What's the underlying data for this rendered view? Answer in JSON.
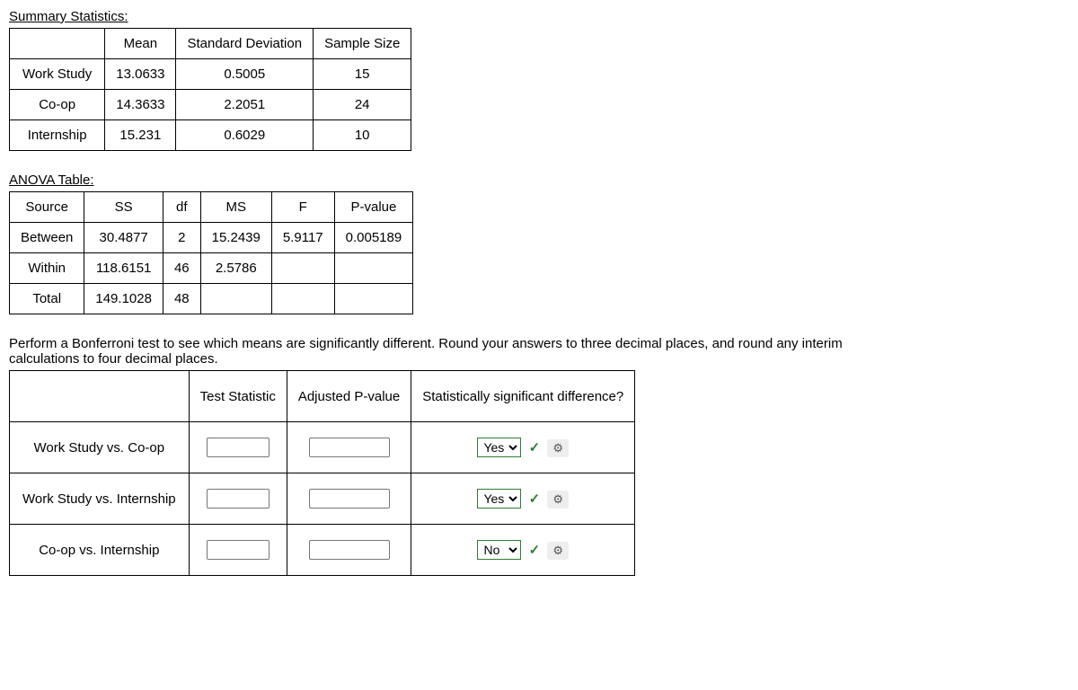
{
  "summary": {
    "title": "Summary Statistics:",
    "headers": {
      "mean": "Mean",
      "sd": "Standard Deviation",
      "n": "Sample Size"
    },
    "rows": [
      {
        "label": "Work Study",
        "mean": "13.0633",
        "sd": "0.5005",
        "n": "15"
      },
      {
        "label": "Co-op",
        "mean": "14.3633",
        "sd": "2.2051",
        "n": "24"
      },
      {
        "label": "Internship",
        "mean": "15.231",
        "sd": "0.6029",
        "n": "10"
      }
    ]
  },
  "anova": {
    "title": "ANOVA Table:",
    "headers": {
      "source": "Source",
      "ss": "SS",
      "df": "df",
      "ms": "MS",
      "f": "F",
      "p": "P-value"
    },
    "rows": [
      {
        "source": "Between",
        "ss": "30.4877",
        "df": "2",
        "ms": "15.2439",
        "f": "5.9117",
        "p": "0.005189"
      },
      {
        "source": "Within",
        "ss": "118.6151",
        "df": "46",
        "ms": "2.5786",
        "f": "",
        "p": ""
      },
      {
        "source": "Total",
        "ss": "149.1028",
        "df": "48",
        "ms": "",
        "f": "",
        "p": ""
      }
    ]
  },
  "bonferroni": {
    "instruction": "Perform a Bonferroni test to see which means are significantly different. Round your answers to three decimal places, and round any interim calculations to four decimal places.",
    "headers": {
      "ts": "Test Statistic",
      "adj": "Adjusted P-value",
      "sig": "Statistically significant difference?"
    },
    "rows": [
      {
        "label": "Work Study vs. Co-op",
        "select": "Yes"
      },
      {
        "label": "Work Study vs. Internship",
        "select": "Yes"
      },
      {
        "label": "Co-op vs. Internship",
        "select": "No"
      }
    ],
    "options": {
      "yes": "Yes",
      "no": "No"
    },
    "gear": "⚙"
  }
}
